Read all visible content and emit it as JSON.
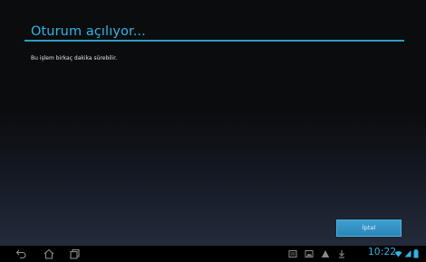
{
  "dialog": {
    "title": "Oturum açılıyor...",
    "message": "Bu işlem birkaç dakika sürebilir.",
    "cancel_label": "İptal"
  },
  "nav": {
    "back_icon": "back-icon",
    "home_icon": "home-icon",
    "recents_icon": "recent-apps-icon"
  },
  "status_bar": {
    "time": "10:22",
    "accent_color": "#33b5e5",
    "icons": [
      "notification-icon",
      "gallery-icon",
      "warning-icon",
      "download-icon",
      "wifi-icon",
      "signal-icon",
      "battery-icon"
    ]
  }
}
